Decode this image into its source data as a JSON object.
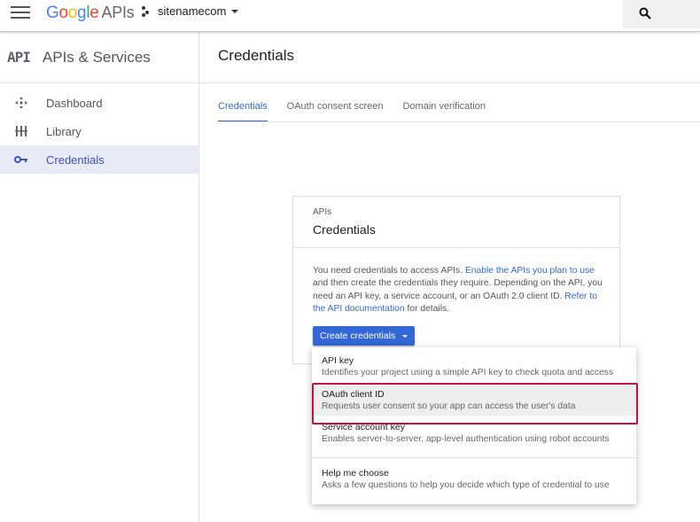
{
  "header": {
    "logo_letters": [
      "G",
      "o",
      "o",
      "g",
      "l",
      "e"
    ],
    "logo_suffix": "APIs",
    "project_name": "sitenamecom"
  },
  "sidebar": {
    "mark": "API",
    "title": "APIs & Services",
    "items": [
      {
        "label": "Dashboard",
        "icon": "dashboard-icon"
      },
      {
        "label": "Library",
        "icon": "library-icon"
      },
      {
        "label": "Credentials",
        "icon": "key-icon",
        "active": true
      }
    ]
  },
  "main": {
    "title": "Credentials",
    "tabs": [
      {
        "label": "Credentials",
        "active": true
      },
      {
        "label": "OAuth consent screen"
      },
      {
        "label": "Domain verification"
      }
    ]
  },
  "card": {
    "eyebrow": "APIs",
    "title": "Credentials",
    "body_1": "You need credentials to access APIs.",
    "link_1": "Enable the APIs you plan to use",
    "body_2": "and then create the credentials they require. Depending on the API, you need an API key, a service account, or an OAuth 2.0 client ID.",
    "link_2": "Refer to the API documentation",
    "body_3": "for details.",
    "button_label": "Create credentials"
  },
  "dropdown": {
    "items": [
      {
        "title": "API key",
        "desc": "Identifies your project using a simple API key to check quota and access"
      },
      {
        "title": "OAuth client ID",
        "desc": "Requests user consent so your app can access the user's data",
        "highlighted": true
      },
      {
        "title": "Service account key",
        "desc": "Enables server-to-server, app-level authentication using robot accounts"
      },
      {
        "title": "Help me choose",
        "desc": "Asks a few questions to help you decide which type of credential to use"
      }
    ]
  },
  "colors": {
    "accent": "#3367d6",
    "active_nav_bg": "#e8eaf6",
    "highlight_border": "#c2123f"
  }
}
